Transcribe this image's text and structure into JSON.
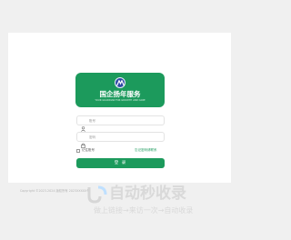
{
  "brand": {
    "name": "国企扬年服务",
    "tagline": "YOUR GUARDIAN FOR GROWTH AND CARE",
    "logo_icon": "logo-mark-icon"
  },
  "login": {
    "username_placeholder": "账号",
    "password_placeholder": "密码",
    "remember_label": "记住账号",
    "forgot_link": "忘记密码请联系",
    "submit_label": "登 录",
    "username_icon": "user-icon",
    "password_icon": "lock-icon"
  },
  "footer": {
    "copyright": "Copyright ©2023-2024 版权所有 2023XXXXX号"
  },
  "watermark": {
    "title": "自动秒收录",
    "slogan": "做上链接→来访一次→自动收录"
  },
  "colors": {
    "accent": "#1c9a5c",
    "logo_blue": "#2f4aa6",
    "page_bg": "#f0f0f0",
    "card_bg": "#ffffff"
  }
}
